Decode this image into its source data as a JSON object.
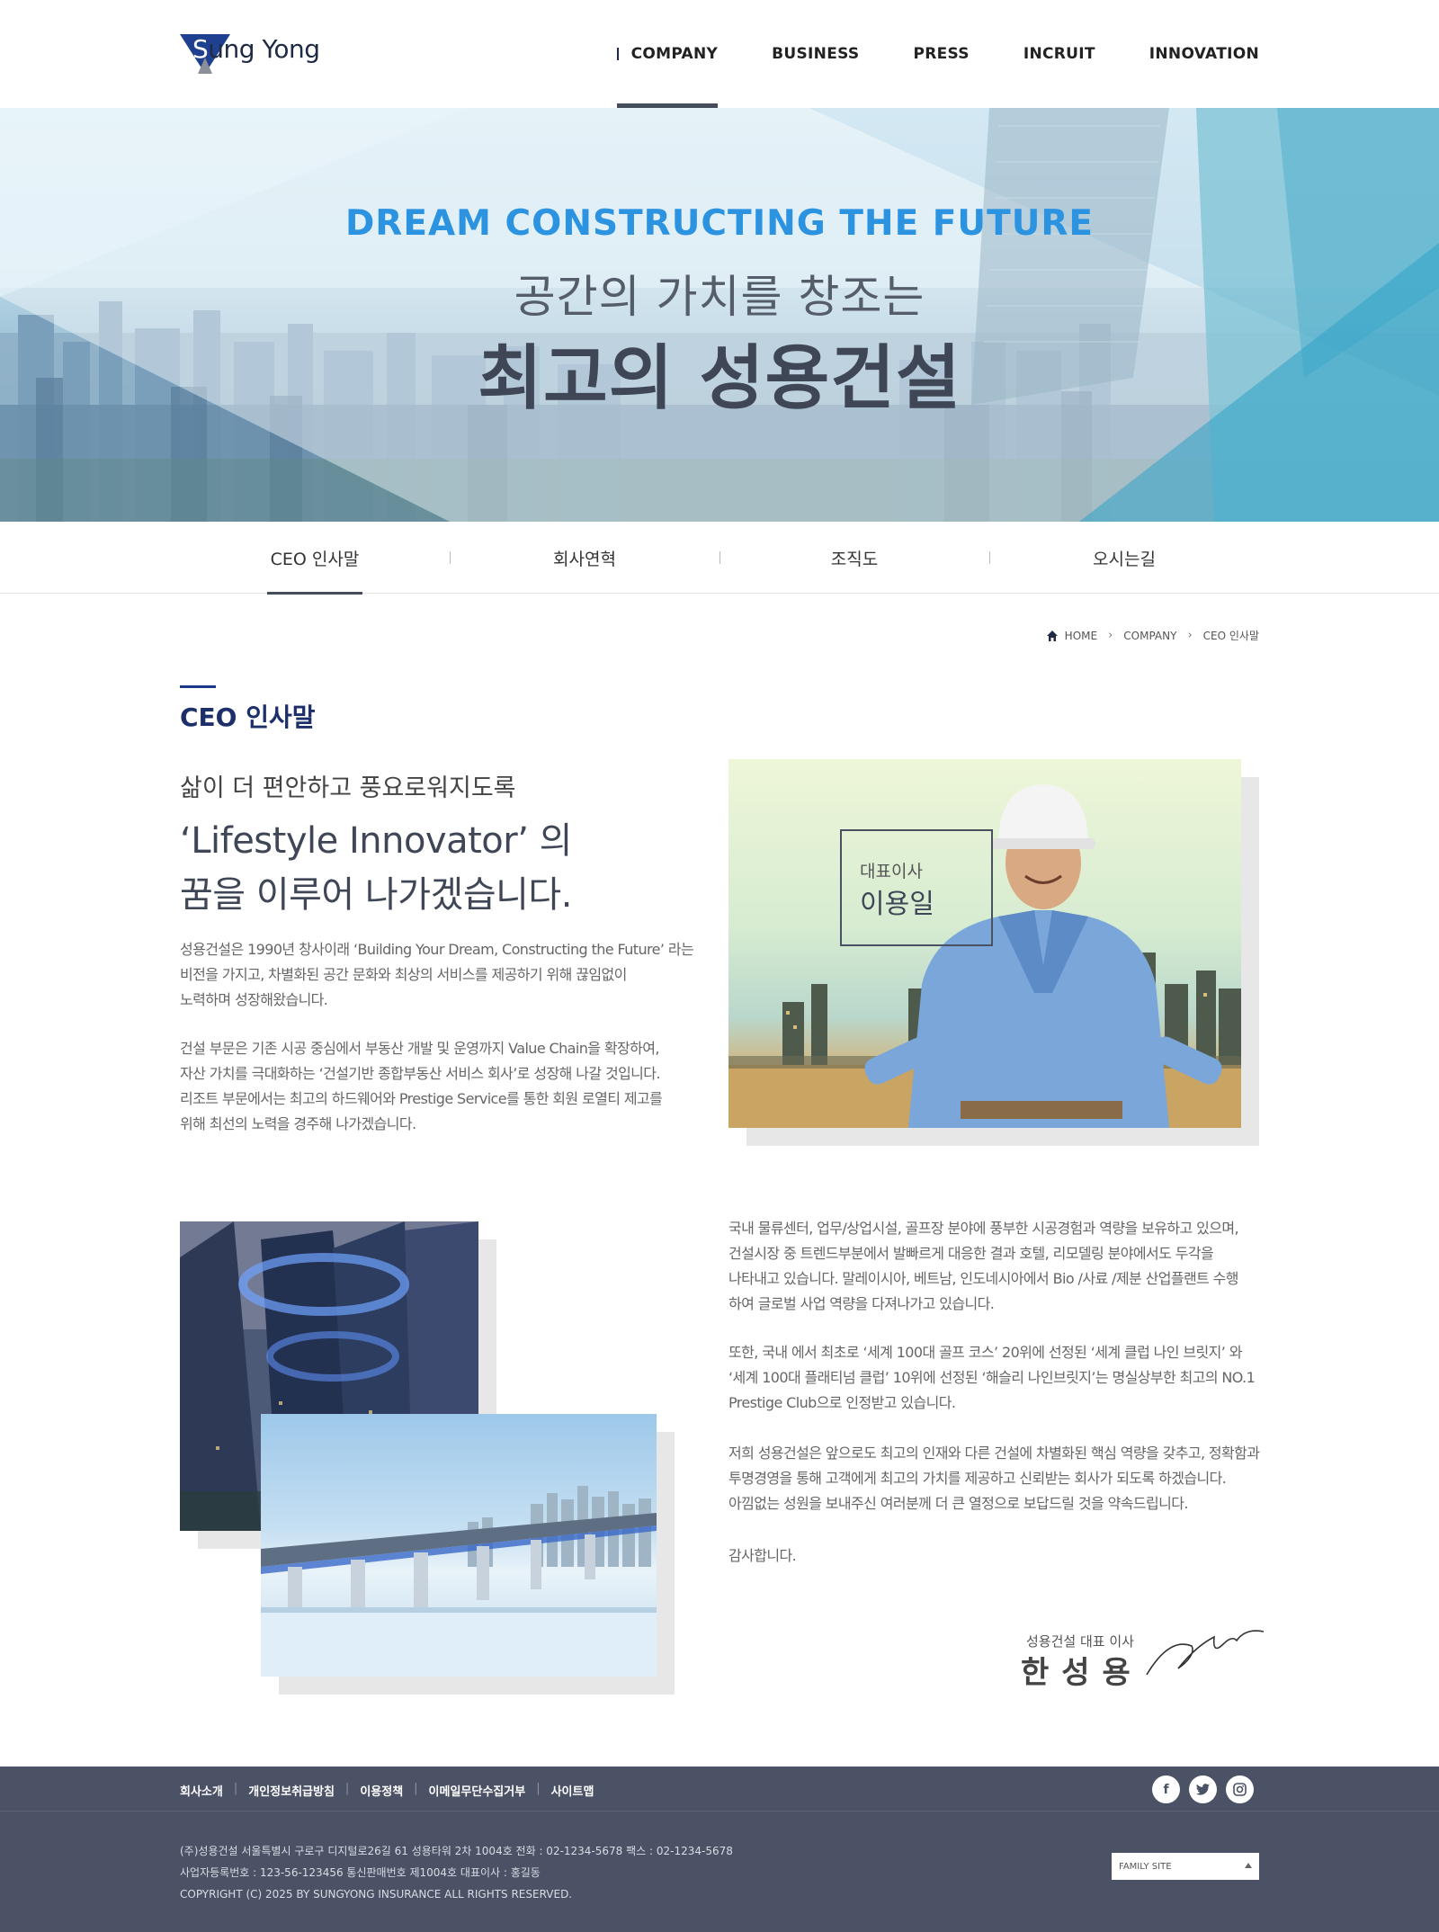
{
  "header": {
    "logo_text_prefix": "S",
    "logo_text_rest": "ung Yong",
    "nav": [
      "COMPANY",
      "BUSINESS",
      "PRESS",
      "INCRUIT",
      "INNOVATION"
    ],
    "active_nav": "COMPANY"
  },
  "hero": {
    "en_title": "DREAM CONSTRUCTING THE FUTURE",
    "sub_title": "공간의 가치를 창조는",
    "main_title": "최고의 성용건설"
  },
  "subnav": {
    "tabs": [
      "CEO 인사말",
      "회사연혁",
      "조직도",
      "오시는길"
    ],
    "active": "CEO 인사말"
  },
  "breadcrumb": {
    "home": "HOME",
    "level1": "COMPANY",
    "level2": "CEO 인사말"
  },
  "content": {
    "section_title": "CEO 인사말",
    "lead_small": "삶이 더 편안하고 풍요로워지도록",
    "lead_big1": "‘Lifestyle Innovator’ 의",
    "lead_big2": "꿈을 이루어 나가겠습니다.",
    "para1": [
      "성용건설은 1990년 창사이래 ‘Building Your Dream, Constructing the Future’ 라는",
      "비전을 가지고, 차별화된 공간 문화와 최상의 서비스를 제공하기 위해 끊임없이",
      "노력하며 성장해왔습니다."
    ],
    "para2": [
      "건설 부문은 기존 시공 중심에서 부동산 개발 및 운영까지 Value Chain을 확장하여,",
      "자산 가치를 극대화하는 ‘건설기반 종합부동산 서비스 회사’로 성장해 나갈 것입니다.",
      "리조트 부문에서는 최고의 하드웨어와 Prestige Service를 통한 회원 로열티 제고를",
      "위해 최선의 노력을 경주해 나가겠습니다."
    ],
    "ceo_role": "대표이사",
    "ceo_name": "이용일",
    "para3": [
      "국내 물류센터, 업무/상업시설, 골프장 분야에 풍부한 시공경험과 역량을 보유하고 있으며,",
      "건설시장 중 트렌드부분에서 발빠르게 대응한 결과 호텔, 리모델링 분야에서도 두각을",
      "나타내고 있습니다. 말레이시아, 베트남, 인도네시아에서 Bio /사료 /제분 산업플랜트 수행",
      "하여 글로벌 사업 역량을 다져나가고 있습니다."
    ],
    "para4": [
      "또한, 국내 에서 최초로 ‘세계 100대 골프 코스’ 20위에 선정된 ‘세계 클럽 나인 브릿지’ 와",
      "‘세계 100대 플래티넘 클럽’ 10위에 선정된 ‘해슬리 나인브릿지’는 명실상부한 최고의 NO.1",
      "Prestige Club으로 인정받고 있습니다."
    ],
    "para5": [
      "저희 성용건설은 앞으로도 최고의 인재와 다른 건설에 차별화된 핵심 역량을 갖추고, 정확함과",
      "투명경영을 통해 고객에게 최고의 가치를 제공하고 신뢰받는 회사가 되도록 하겠습니다.",
      "아낌없는 성원을 보내주신 여러분께 더 큰 열정으로 보답드릴 것을 약속드립니다."
    ],
    "thanks": "감사합니다.",
    "sign_role": "성용건설 대표 이사",
    "sign_name": "한성용"
  },
  "footer": {
    "links": [
      "회사소개",
      "개인정보취급방침",
      "이용정책",
      "이메일무단수집거부",
      "사이트맵"
    ],
    "social": [
      "facebook-icon",
      "twitter-icon",
      "instagram-icon"
    ],
    "info1": "(주)성용건설 서울특별시 구로구 디지털로26길 61 성용타워 2차 1004호    전화 : 02-1234-5678    팩스 : 02-1234-5678",
    "info2": "사업자등록번호 : 123-56-123456    통신판매번호 제1004호    대표이사 : 홍길동",
    "copyright": "COPYRIGHT (C) 2025 BY SUNGYONG INSURANCE ALL RIGHTS RESERVED.",
    "family_site": "FAMILY SITE"
  },
  "colors": {
    "accent_blue": "#2b93e0",
    "navy": "#1d2f6b",
    "footer_bg": "#4b5266",
    "text_dark": "#3f4656"
  }
}
